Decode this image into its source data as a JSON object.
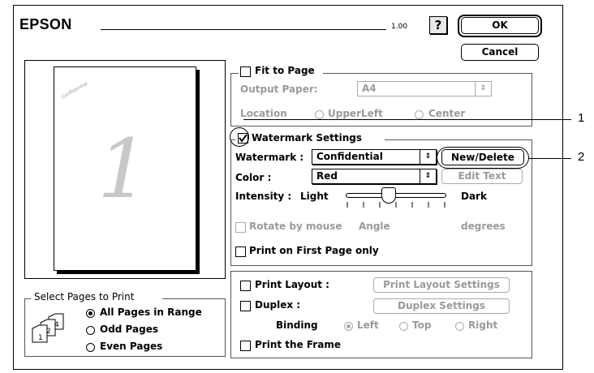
{
  "header": {
    "brand": "EPSON",
    "version": "1.00",
    "help_label": "?"
  },
  "buttons": {
    "ok": "OK",
    "cancel": "Cancel"
  },
  "preview": {
    "page_number": "1",
    "watermark_mini": "Confidential"
  },
  "fit_to_page": {
    "label": "Fit to Page",
    "checked": false,
    "output_paper_label": "Output Paper:",
    "output_paper_value": "A4",
    "location_label": "Location",
    "options": [
      "UpperLeft",
      "Center"
    ]
  },
  "watermark_settings": {
    "label": "Watermark Settings",
    "checked": true,
    "watermark_label": "Watermark :",
    "watermark_value": "Confidential",
    "new_delete_label": "New/Delete",
    "color_label": "Color :",
    "color_value": "Red",
    "edit_text_label": "Edit Text",
    "intensity_label": "Intensity :",
    "intensity_light": "Light",
    "intensity_dark": "Dark",
    "intensity_level": 0.43,
    "rotate_label": "Rotate by mouse",
    "angle_label": "Angle",
    "degrees_label": "degrees",
    "first_page_label": "Print on First Page only"
  },
  "layout": {
    "print_layout_label": "Print Layout :",
    "print_layout_settings": "Print Layout Settings",
    "duplex_label": "Duplex :",
    "duplex_settings": "Duplex Settings",
    "binding_label": "Binding",
    "binding_options": [
      "Left",
      "Top",
      "Right"
    ],
    "print_frame_label": "Print the Frame"
  },
  "select_pages": {
    "title": "Select Pages to Print",
    "options": [
      "All Pages in Range",
      "Odd Pages",
      "Even Pages"
    ],
    "selected": 0
  },
  "callouts": [
    "1",
    "2"
  ]
}
